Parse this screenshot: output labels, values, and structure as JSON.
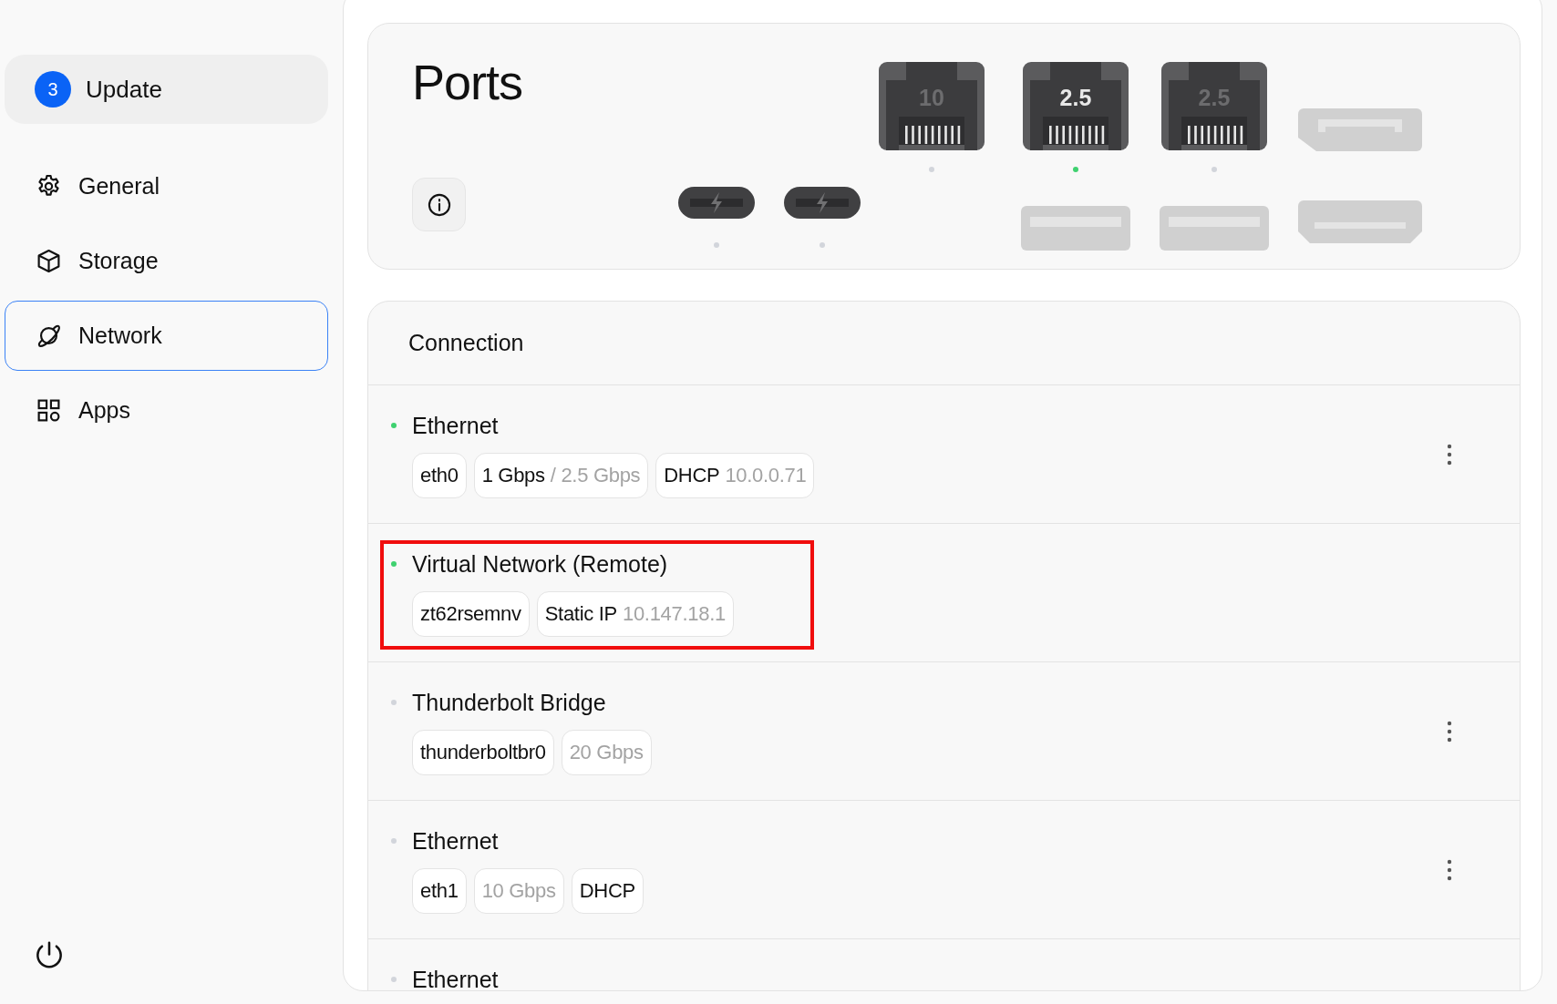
{
  "sidebar": {
    "update": {
      "badge": "3",
      "label": "Update"
    },
    "nav": [
      {
        "label": "General",
        "selected": false
      },
      {
        "label": "Storage",
        "selected": false
      },
      {
        "label": "Network",
        "selected": true
      },
      {
        "label": "Apps",
        "selected": false
      }
    ]
  },
  "ports": {
    "title": "Ports",
    "columns": [
      [
        {
          "kind": "thunderbolt",
          "active": false
        }
      ],
      [
        {
          "kind": "thunderbolt",
          "active": false
        }
      ],
      [
        {
          "kind": "rj45",
          "label": "10",
          "active": false
        }
      ],
      [
        {
          "kind": "rj45",
          "label": "2.5",
          "active": true
        },
        {
          "kind": "usb-a"
        }
      ],
      [
        {
          "kind": "rj45",
          "label": "2.5",
          "active": false
        },
        {
          "kind": "usb-a"
        }
      ],
      [
        {
          "kind": "displayport"
        },
        {
          "kind": "hdmi"
        }
      ]
    ]
  },
  "connection": {
    "title": "Connection",
    "rows": [
      {
        "name": "Ethernet",
        "online": true,
        "highlighted": false,
        "menu": true,
        "chips": [
          {
            "text": "eth0"
          },
          {
            "text": "1 Gbps",
            "detail": "/ 2.5 Gbps"
          },
          {
            "text": "DHCP",
            "detail": "10.0.0.71"
          }
        ]
      },
      {
        "name": "Virtual Network (Remote)",
        "online": true,
        "highlighted": true,
        "menu": false,
        "chips": [
          {
            "text": "zt62rsemnv"
          },
          {
            "text": "Static IP",
            "detail": "10.147.18.1"
          }
        ]
      },
      {
        "name": "Thunderbolt Bridge",
        "online": false,
        "highlighted": false,
        "menu": true,
        "chips": [
          {
            "text": "thunderboltbr0"
          },
          {
            "detail": "20 Gbps"
          }
        ]
      },
      {
        "name": "Ethernet",
        "online": false,
        "highlighted": false,
        "menu": true,
        "chips": [
          {
            "text": "eth1"
          },
          {
            "detail": "10 Gbps"
          },
          {
            "text": "DHCP"
          }
        ]
      },
      {
        "name": "Ethernet",
        "online": false,
        "highlighted": false,
        "menu": false
      }
    ]
  }
}
